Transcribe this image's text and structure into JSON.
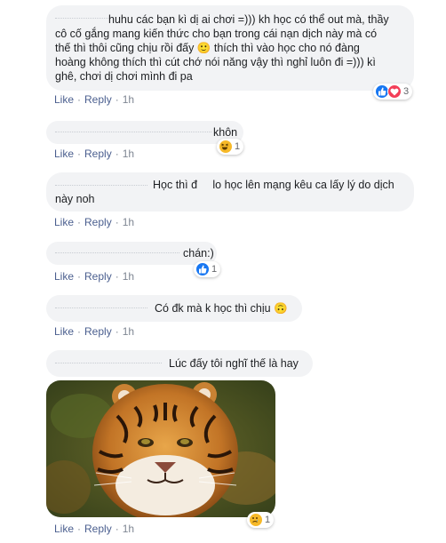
{
  "comments": [
    {
      "text_lines": [
        "huhu các bạn kì dị ai chơi =))) kh học có thể out mà, thầy",
        "cô cố gắng mang kiến thức cho bạn trong cái nạn dịch này mà có",
        "thế thì thôi cũng chịu rồi đấy 🙂 thích thì vào học cho nó đàng",
        "hoàng không thích thì cút chớ nói năng vậy thì nghỉ luôn đi =))) kì",
        "ghê, chơi dị chơi mình đi pa"
      ],
      "reactions": {
        "icons": [
          "like-icon",
          "love-icon"
        ],
        "count": "3"
      },
      "like": "Like",
      "reply": "Reply",
      "time": "1h"
    },
    {
      "text_lines": [
        "khôn"
      ],
      "reactions": {
        "icons": [
          "haha-icon"
        ],
        "count": "1"
      },
      "like": "Like",
      "reply": "Reply",
      "time": "1h"
    },
    {
      "text_lines": [
        "Học thì đ     lo học lên mạng kêu ca lấy lý do dịch",
        "này noh"
      ],
      "like": "Like",
      "reply": "Reply",
      "time": "1h"
    },
    {
      "text_lines": [
        "chán:)"
      ],
      "reactions": {
        "icons": [
          "like-icon"
        ],
        "count": "1"
      },
      "like": "Like",
      "reply": "Reply",
      "time": "1h"
    },
    {
      "text_lines": [
        "Có đk mà k học thì chịu 🙃"
      ],
      "like": "Like",
      "reply": "Reply",
      "time": "1h"
    },
    {
      "text_lines": [
        "Lúc đấy tôi nghĩ thế là hay"
      ],
      "reactions": {
        "icons": [
          "sad-icon"
        ],
        "count": "1"
      },
      "like": "Like",
      "reply": "Reply",
      "time": "1h"
    }
  ],
  "colors": {
    "bubble": "#f2f3f5",
    "link": "#4b5f8f",
    "like_blue": "#1877f2",
    "love_red": "#f33e58"
  }
}
